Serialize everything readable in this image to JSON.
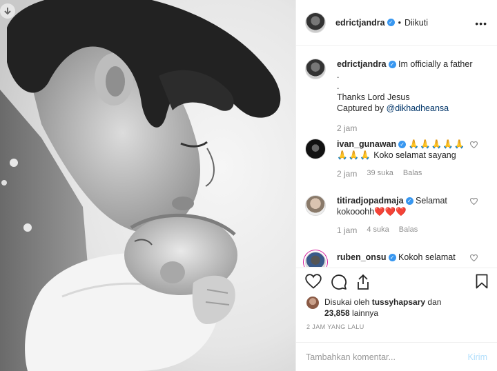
{
  "post": {
    "username": "edrictjandra",
    "follow_status": "Diikuti",
    "more_icon": "more-icon"
  },
  "caption": {
    "username": "edrictjandra",
    "line1": "Im officially a father",
    "line2": ".",
    "line3": ".",
    "line4": "Thanks Lord Jesus",
    "line5_prefix": "Captured by ",
    "mention": "@dikhadheansa",
    "time": "2 jam"
  },
  "comments": [
    {
      "username": "ivan_gunawan",
      "emoji_line1": "🙏🙏🙏🙏🙏",
      "emoji_line2": "🙏🙏🙏",
      "text": "Koko selamat sayang",
      "time": "2 jam",
      "likes": "39 suka",
      "reply": "Balas"
    },
    {
      "username": "titiradjopadmaja",
      "text1": "Selamat",
      "text2": "kokooohh",
      "hearts": "❤️❤️❤️",
      "time": "1 jam",
      "likes": "4 suka",
      "reply": "Balas"
    },
    {
      "username": "ruben_onsu",
      "text": "Kokoh selamat"
    }
  ],
  "likes": {
    "prefix": "Disukai oleh ",
    "user": "tussyhapsary",
    "mid": " dan",
    "count": "23,858",
    "suffix": " lainnya"
  },
  "timestamp": "2 JAM YANG LALU",
  "composer": {
    "placeholder": "Tambahkan komentar...",
    "send": "Kirim"
  },
  "colors": {
    "verified": "#3897f0",
    "link": "#003569",
    "muted": "#8e8e8e",
    "send_disabled": "#b2dffc"
  }
}
